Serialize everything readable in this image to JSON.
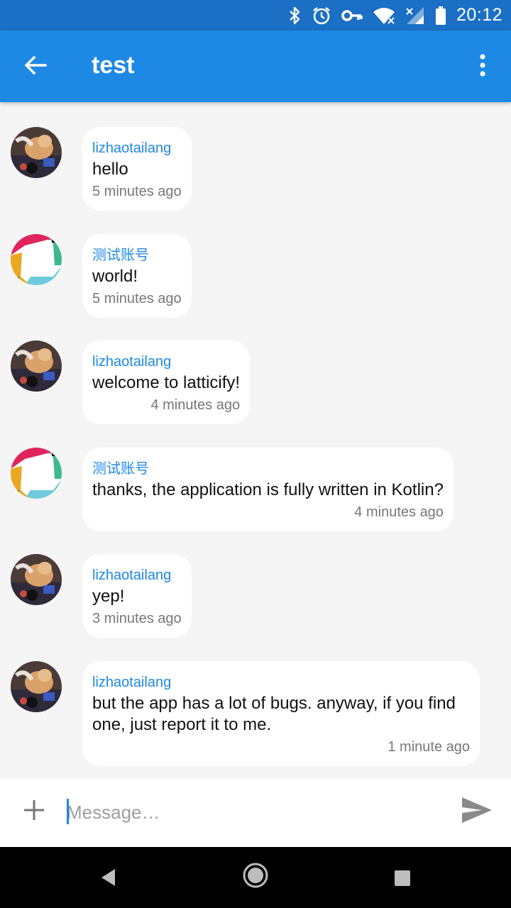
{
  "status_bar": {
    "time": "20:12",
    "icons": [
      "bluetooth-icon",
      "alarm-icon",
      "vpn-key-icon",
      "wifi-icon",
      "signal-icon",
      "battery-icon"
    ],
    "color": "#1b6fc4"
  },
  "app_bar": {
    "title": "test",
    "color": "#1e88e5",
    "back_icon": "arrow-left-icon",
    "menu_icon": "more-vertical-icon"
  },
  "messages": [
    {
      "sender": "lizhaotailang",
      "text": "hello",
      "time": "5 minutes ago",
      "avatar": "cat-photo-avatar"
    },
    {
      "sender": "测试账号",
      "text": "world!",
      "time": "5 minutes ago",
      "avatar": "colorful-square-avatar"
    },
    {
      "sender": "lizhaotailang",
      "text": "welcome to latticify!",
      "time": "4 minutes ago",
      "avatar": "cat-photo-avatar"
    },
    {
      "sender": "测试账号",
      "text": "thanks, the application is fully written in Kotlin?",
      "time": "4 minutes ago",
      "avatar": "colorful-square-avatar"
    },
    {
      "sender": "lizhaotailang",
      "text": "yep!",
      "time": "3 minutes ago",
      "avatar": "cat-photo-avatar"
    },
    {
      "sender": "lizhaotailang",
      "text": "but the app has a lot of bugs. anyway, if you find one, just report it to me.",
      "time": "1 minute ago",
      "avatar": "cat-photo-avatar"
    }
  ],
  "composer": {
    "placeholder": "Message…",
    "value": "",
    "add_icon": "plus-icon",
    "send_icon": "send-icon"
  },
  "nav_bar": {
    "icons": [
      "nav-back-icon",
      "nav-home-icon",
      "nav-recents-icon"
    ]
  }
}
